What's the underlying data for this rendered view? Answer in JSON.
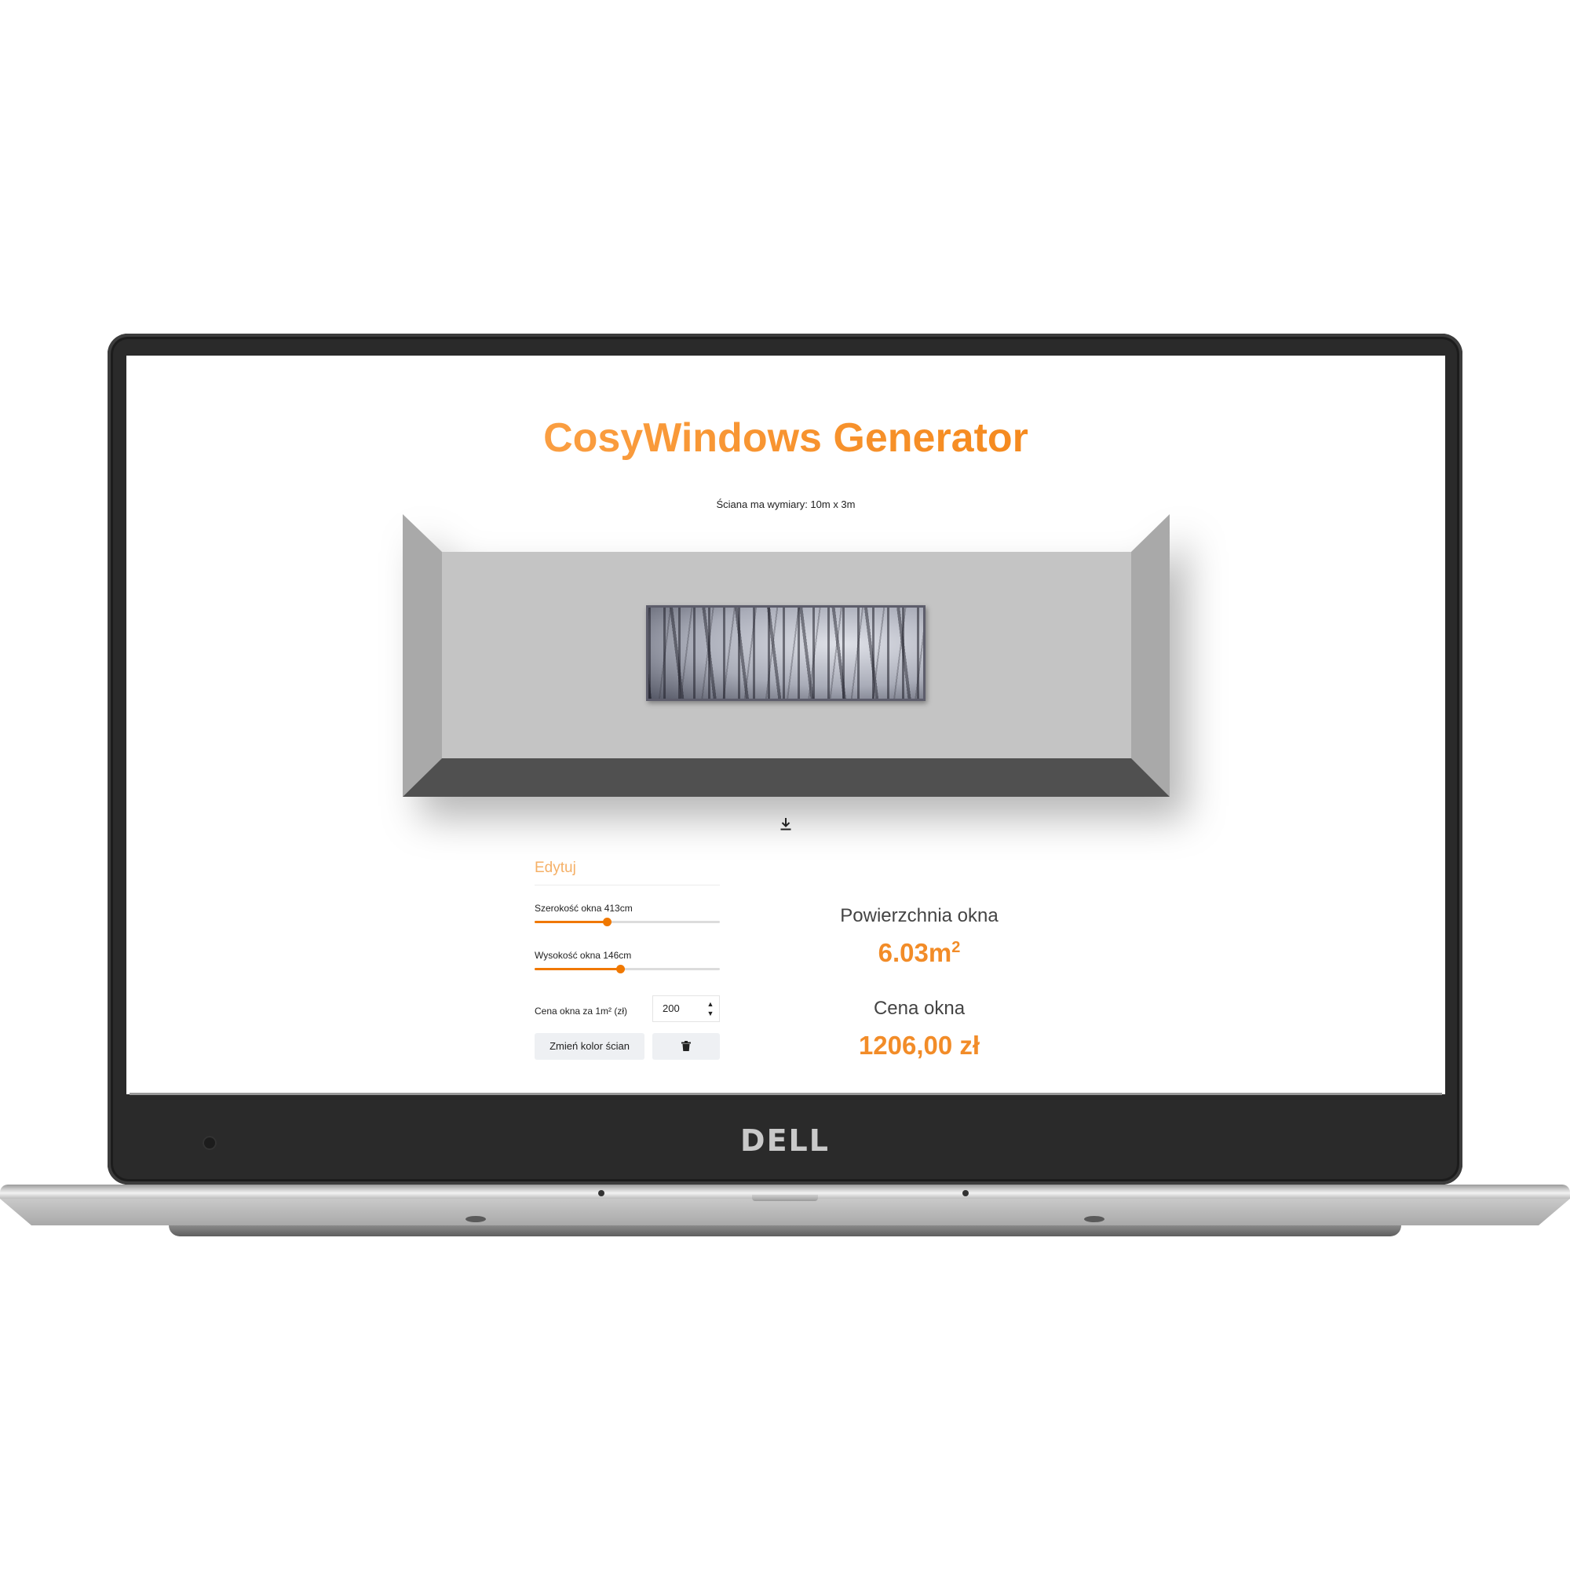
{
  "app": {
    "title": "CosyWindows Generator",
    "wall_dimensions": "Ściana ma wymiary: 10m x 3m"
  },
  "editor": {
    "heading": "Edytuj",
    "width_slider": {
      "label": "Szerokość okna 413cm",
      "value_fraction": 0.39
    },
    "height_slider": {
      "label": "Wysokość okna 146cm",
      "value_fraction": 0.46
    },
    "price_label": "Cena okna za 1m² (zł)",
    "price_value": "200",
    "change_color_button": "Zmień kolor ścian"
  },
  "results": {
    "area_label": "Powierzchnia okna",
    "area_value": "6.03m",
    "area_sup": "2",
    "price_label": "Cena okna",
    "price_value": "1206,00 zł"
  },
  "device": {
    "brand": "DELL"
  },
  "colors": {
    "accent": "#f07800",
    "wall_back": "#c4c4c4",
    "wall_side": "#a9a9a9",
    "floor": "#505050"
  },
  "icons": {
    "download": "download-icon",
    "trash": "trash-icon"
  }
}
